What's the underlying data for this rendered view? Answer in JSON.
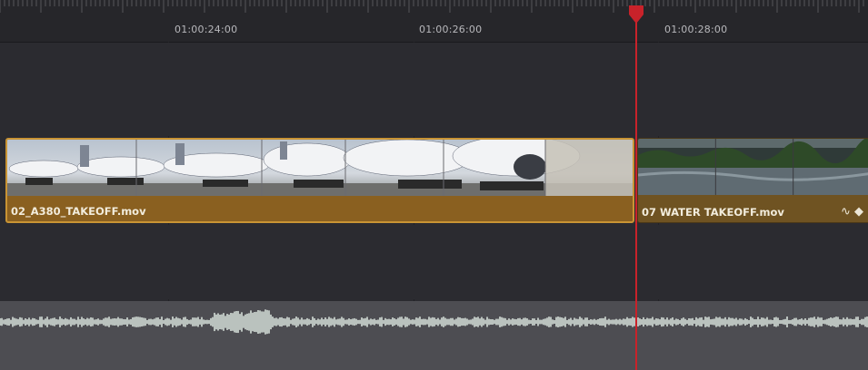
{
  "ruler": {
    "timecodes": [
      "01:00:24:00",
      "01:00:26:00",
      "01:00:28:00"
    ]
  },
  "video_track": {
    "clips": [
      {
        "name": "02_A380_TAKEOFF.mov",
        "selected": true
      },
      {
        "name": "07 WATER TAKEOFF.mov",
        "selected": false,
        "icons": [
          "curve-icon",
          "keyframe-icon"
        ]
      }
    ]
  },
  "audio_track": {
    "label": ""
  },
  "colors": {
    "playhead": "#c8222a",
    "clip_selected": "#8a6020",
    "clip_border_selected": "#c99434",
    "clip": "#6f5322",
    "audio_bg": "#4d4d52",
    "waveform": "#dfe9e2"
  }
}
